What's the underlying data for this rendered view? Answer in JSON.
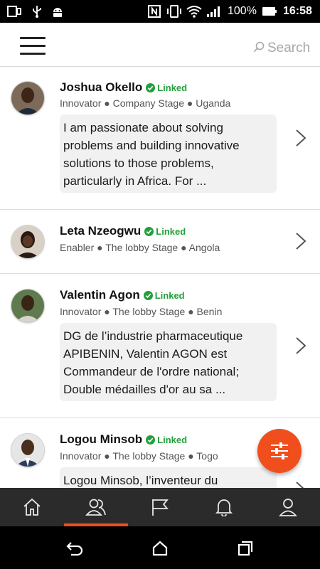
{
  "status_bar": {
    "battery_percent": "100%",
    "time": "16:58",
    "icons": [
      "gallery-icon",
      "usb-icon",
      "android-icon",
      "nfc-icon",
      "vibrate-icon",
      "wifi-icon",
      "signal-icon",
      "battery-icon"
    ]
  },
  "header": {
    "menu_icon": "hamburger-menu-icon",
    "search_icon": "search-icon",
    "search_label": "Search"
  },
  "people": [
    {
      "name": "Joshua Okello",
      "linked_label": "Linked",
      "meta": "Innovator ● Company Stage ● Uganda",
      "bio": "I am passionate about solving problems and building innovative solutions to those problems, particularly in Africa. For ..."
    },
    {
      "name": "Leta Nzeogwu",
      "linked_label": "Linked",
      "meta": "Enabler ● The lobby Stage ● Angola",
      "bio": ""
    },
    {
      "name": "Valentin Agon",
      "linked_label": "Linked",
      "meta": "Innovator ● The lobby Stage ● Benin",
      "bio": "DG de l’industrie pharmaceutique APIBENIN, Valentin AGON est Commandeur de l'ordre national; Double médailles d'or au sa ..."
    },
    {
      "name": "Logou Minsob",
      "linked_label": "Linked",
      "meta": "Innovator ● The lobby Stage ● Togo",
      "bio": "Logou Minsob, l’inventeur du"
    }
  ],
  "fab": {
    "icon": "filter-sliders-icon"
  },
  "bottom_nav": {
    "items": [
      "home-icon",
      "people-icon",
      "flag-icon",
      "bell-icon",
      "profile-icon"
    ],
    "active": "people-icon"
  },
  "colors": {
    "accent": "#f04e1c",
    "linked_green": "#22a03a",
    "bottom_nav_bg": "#2b2b2b"
  }
}
